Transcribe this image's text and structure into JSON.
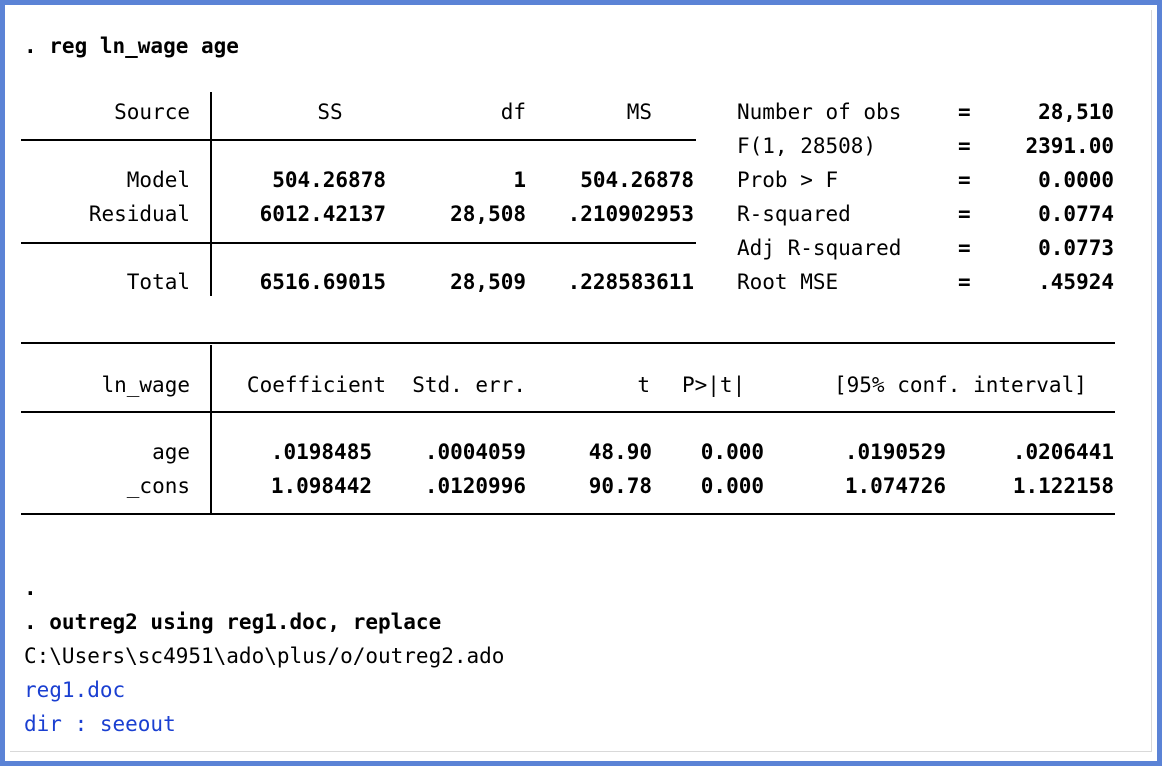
{
  "command_reg": ". reg ln_wage age",
  "anova": {
    "headers": {
      "source": "Source",
      "ss": "SS",
      "df": "df",
      "ms": "MS"
    },
    "rows": [
      {
        "source": "Model",
        "ss": "504.26878",
        "df": "1",
        "ms": "504.26878"
      },
      {
        "source": "Residual",
        "ss": "6012.42137",
        "df": "28,508",
        "ms": ".210902953"
      },
      {
        "source": "Total",
        "ss": "6516.69015",
        "df": "28,509",
        "ms": ".228583611"
      }
    ]
  },
  "stats": [
    {
      "label": "Number of obs",
      "eq": "=",
      "value": "28,510"
    },
    {
      "label": "F(1, 28508)",
      "eq": "=",
      "value": "2391.00"
    },
    {
      "label": "Prob > F",
      "eq": "=",
      "value": "0.0000"
    },
    {
      "label": "R-squared",
      "eq": "=",
      "value": "0.0774"
    },
    {
      "label": "Adj R-squared",
      "eq": "=",
      "value": "0.0773"
    },
    {
      "label": "Root MSE",
      "eq": "=",
      "value": ".45924"
    }
  ],
  "coef": {
    "headers": {
      "var": "ln_wage",
      "coef": "Coefficient",
      "se": "Std. err.",
      "t": "t",
      "p": "P>|t|",
      "ci": "[95% conf. interval]"
    },
    "rows": [
      {
        "var": "age",
        "coef": ".0198485",
        "se": ".0004059",
        "t": "48.90",
        "p": "0.000",
        "lo": ".0190529",
        "hi": ".0206441"
      },
      {
        "var": "_cons",
        "coef": "1.098442",
        "se": ".0120996",
        "t": "90.78",
        "p": "0.000",
        "lo": "1.074726",
        "hi": "1.122158"
      }
    ]
  },
  "after": {
    "dot": ".",
    "command_outreg": ". outreg2 using reg1.doc, replace",
    "path": "C:\\Users\\sc4951\\ado\\plus/o/outreg2.ado",
    "link_doc": "reg1.doc",
    "link_dir_prefix": "dir : ",
    "link_dir": "seeout"
  }
}
